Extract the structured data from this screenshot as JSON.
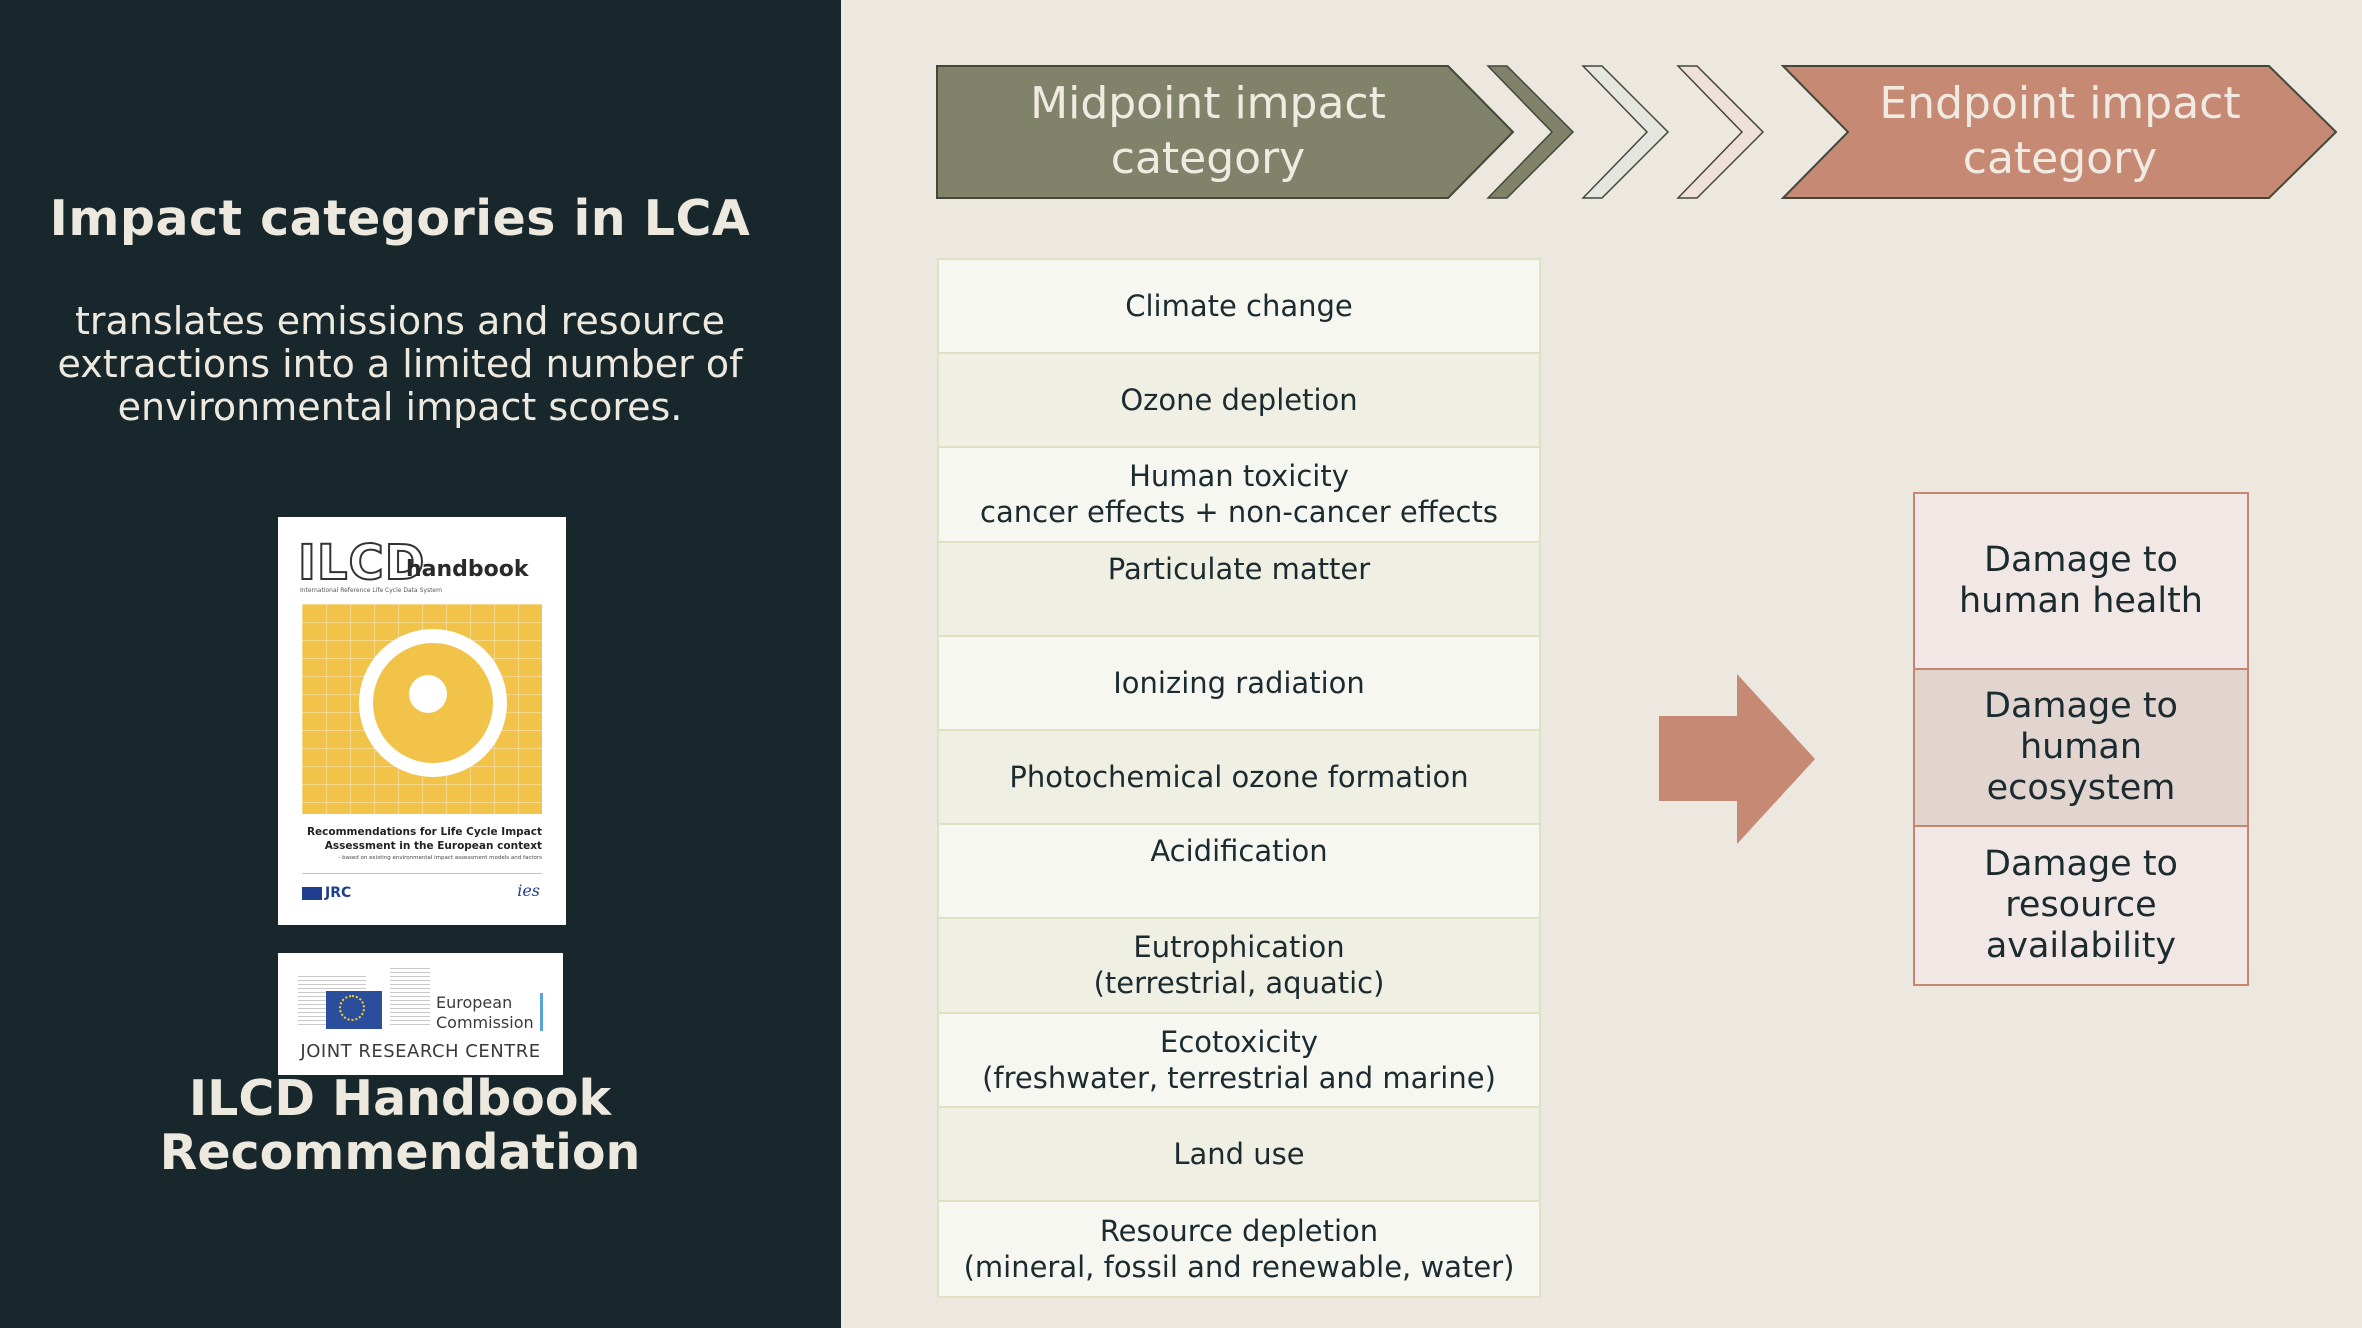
{
  "left_panel": {
    "title": "Impact categories in LCA",
    "subtitle_lines": [
      "translates emissions and resource",
      "extractions into a limited number of",
      "environmental impact scores."
    ],
    "cover": {
      "logo_text": "ILCD",
      "logo_suffix": "handbook",
      "tagline": "International Reference Life Cycle Data System",
      "heading_line1": "Recommendations for Life Cycle Impact",
      "heading_line2": "Assessment in the European context",
      "heading_sub": "- based on existing environmental impact assessment models and factors",
      "jrc_label": "JRC",
      "ies_label": "ies"
    },
    "ec_logo": {
      "line1": "European",
      "line2": "Commission",
      "caption": "JOINT RESEARCH CENTRE"
    },
    "footer_lines": [
      "ILCD Handbook",
      "Recommendation"
    ]
  },
  "header": {
    "midpoint_lines": [
      "Midpoint impact",
      "category"
    ],
    "endpoint_lines": [
      "Endpoint impact",
      "category"
    ],
    "colors": {
      "midpoint": "#808369",
      "chevron_green": "#808369",
      "chevron_grey": "#e5e6df",
      "chevron_pink": "#f0e0dc",
      "endpoint": "#c68973"
    }
  },
  "midpoint_categories": [
    {
      "line1": "Climate change",
      "line2": ""
    },
    {
      "line1": "Ozone depletion",
      "line2": ""
    },
    {
      "line1": "Human toxicity",
      "line2": "cancer effects + non-cancer effects"
    },
    {
      "line1": "Particulate matter",
      "line2": ""
    },
    {
      "line1": "Ionizing radiation",
      "line2": ""
    },
    {
      "line1": "Photochemical ozone formation",
      "line2": ""
    },
    {
      "line1": "Acidification",
      "line2": ""
    },
    {
      "line1": "Eutrophication",
      "line2": "(terrestrial, aquatic)"
    },
    {
      "line1": "Ecotoxicity",
      "line2": "(freshwater, terrestrial and marine)"
    },
    {
      "line1": "Land use",
      "line2": ""
    },
    {
      "line1": "Resource depletion",
      "line2": "(mineral, fossil and renewable, water)"
    }
  ],
  "arrow": {
    "icon": "right-arrow-icon",
    "color": "#c68973"
  },
  "endpoint_categories": [
    {
      "lines": [
        "Damage to",
        "human health"
      ]
    },
    {
      "lines": [
        "Damage to",
        "human",
        "ecosystem"
      ]
    },
    {
      "lines": [
        "Damage to",
        "resource",
        "availability"
      ]
    }
  ]
}
